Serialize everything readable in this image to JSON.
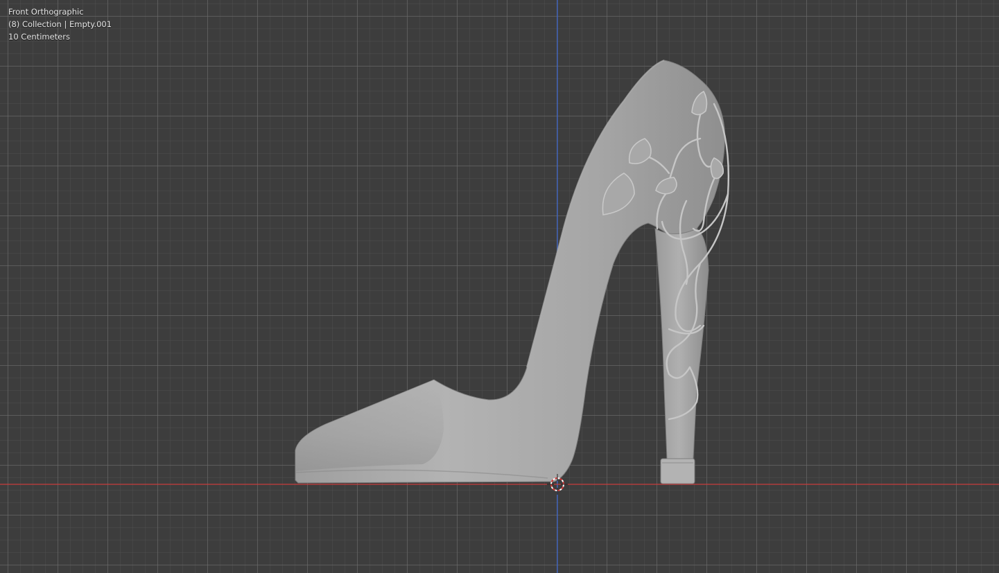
{
  "viewport": {
    "view_name": "Front Orthographic",
    "collection_info": "(8) Collection | Empty.001",
    "grid_scale": "10 Centimeters"
  },
  "colors": {
    "background": "#3d3d3d",
    "x_axis": "#c83c3c",
    "z_axis": "#3c64c8",
    "model": "#a9a9a9",
    "cursor_red": "#d23c3c"
  },
  "scene": {
    "object": "high-heel-shoe",
    "decoration": "vine-leaf-relief",
    "cursor": "3d-cursor-icon"
  }
}
